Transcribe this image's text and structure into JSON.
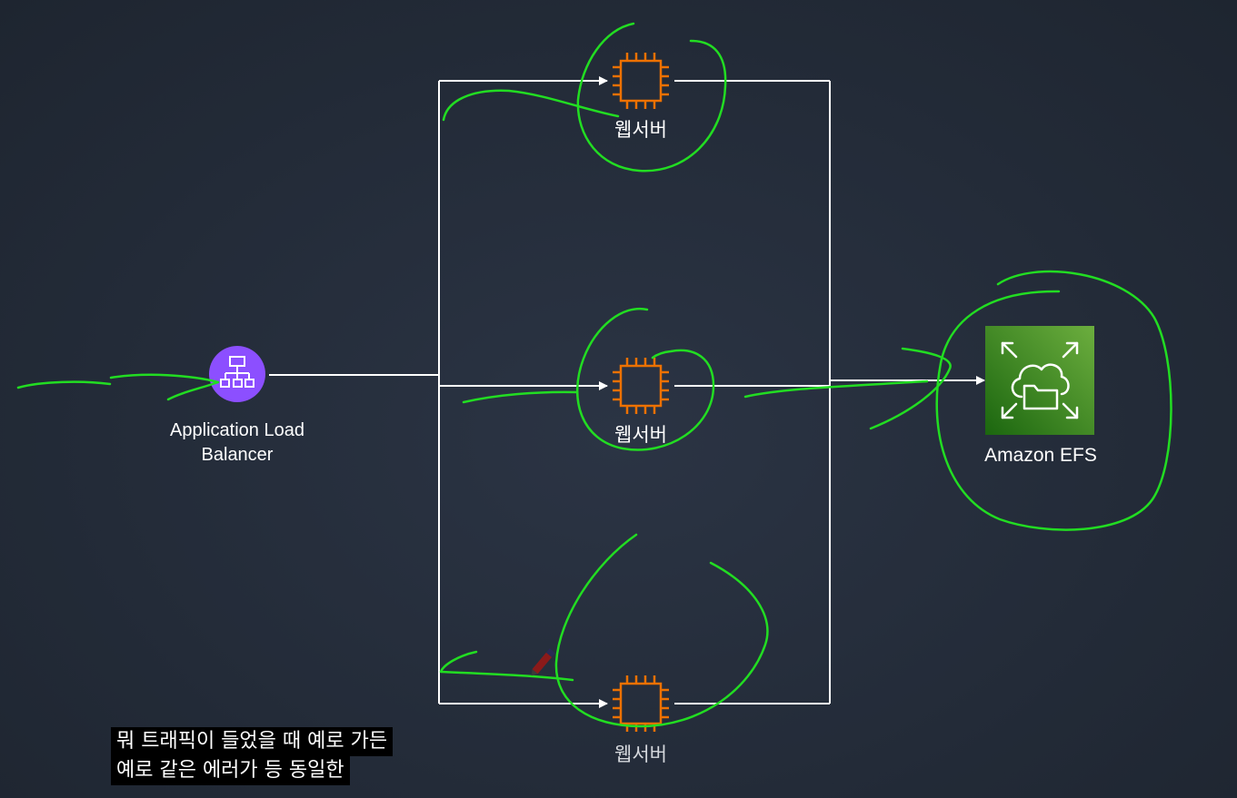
{
  "nodes": {
    "load_balancer": {
      "label_line1": "Application Load",
      "label_line2": "Balancer",
      "icon": "load-balancer-icon",
      "color": "#8c4fff"
    },
    "web_servers": [
      {
        "label": "웹서버",
        "icon": "ec2-instance-icon"
      },
      {
        "label": "웹서버",
        "icon": "ec2-instance-icon"
      },
      {
        "label": "웹서버",
        "icon": "ec2-instance-icon"
      }
    ],
    "efs": {
      "label": "Amazon EFS",
      "icon": "efs-icon",
      "color": "#3f8624"
    }
  },
  "subtitle": {
    "line1": "뭐 트래픽이 들었을 때 예로 가든",
    "line2": "예로 같은 에러가 등 동일한"
  },
  "colors": {
    "background": "#232b38",
    "connector": "#ffffff",
    "instance_orange": "#ed7100",
    "annotation_green": "#22dd22"
  }
}
